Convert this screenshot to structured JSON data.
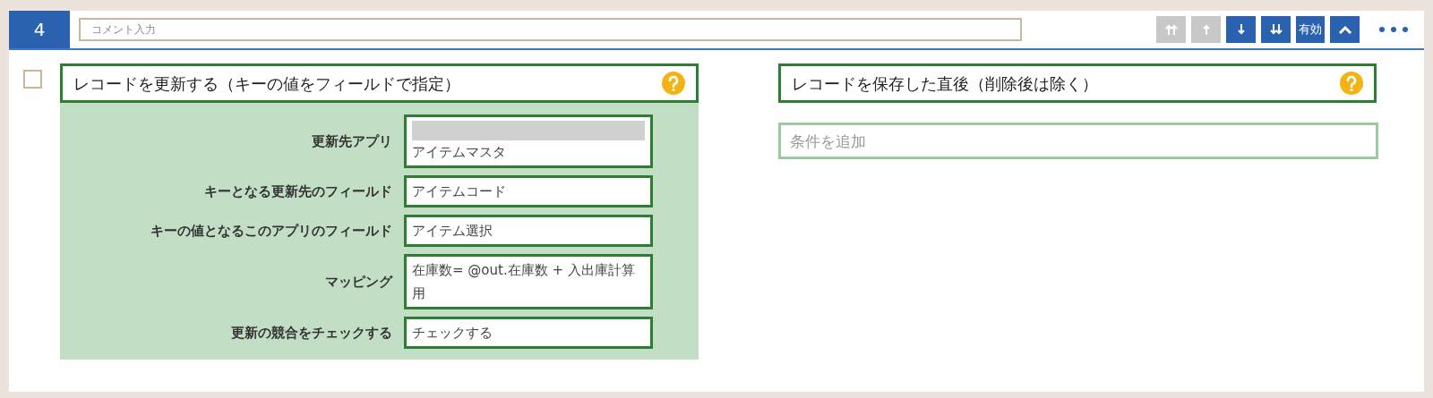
{
  "step": {
    "number": "4",
    "comment": {
      "placeholder": "コメント入力"
    },
    "toolbar": [
      {
        "kind": "top",
        "disabled": true
      },
      {
        "kind": "up",
        "disabled": true
      },
      {
        "kind": "down",
        "disabled": false
      },
      {
        "kind": "bottom",
        "disabled": false
      },
      {
        "kind": "text",
        "label": "有効",
        "disabled": false
      },
      {
        "kind": "collapse",
        "disabled": false
      },
      {
        "kind": "more",
        "disabled": false
      }
    ]
  },
  "action": {
    "checked": false,
    "title": "レコードを更新する（キーの値をフィールドで指定）",
    "settings": [
      {
        "label": "更新先アプリ",
        "value": "アイテムマスタ",
        "redacted": true
      },
      {
        "label": "キーとなる更新先のフィールド",
        "value": "アイテムコード",
        "redacted": false
      },
      {
        "label": "キーの値となるこのアプリのフィールド",
        "value": "アイテム選択",
        "redacted": false
      },
      {
        "label": "マッピング",
        "value": "在庫数= @out.在庫数 + 入出庫計算用",
        "redacted": false
      },
      {
        "label": "更新の競合をチェックする",
        "value": "チェックする",
        "redacted": false
      }
    ]
  },
  "trigger": {
    "title": "レコードを保存した直後（削除後は除く）",
    "condition": {
      "placeholder": "条件を追加"
    }
  }
}
